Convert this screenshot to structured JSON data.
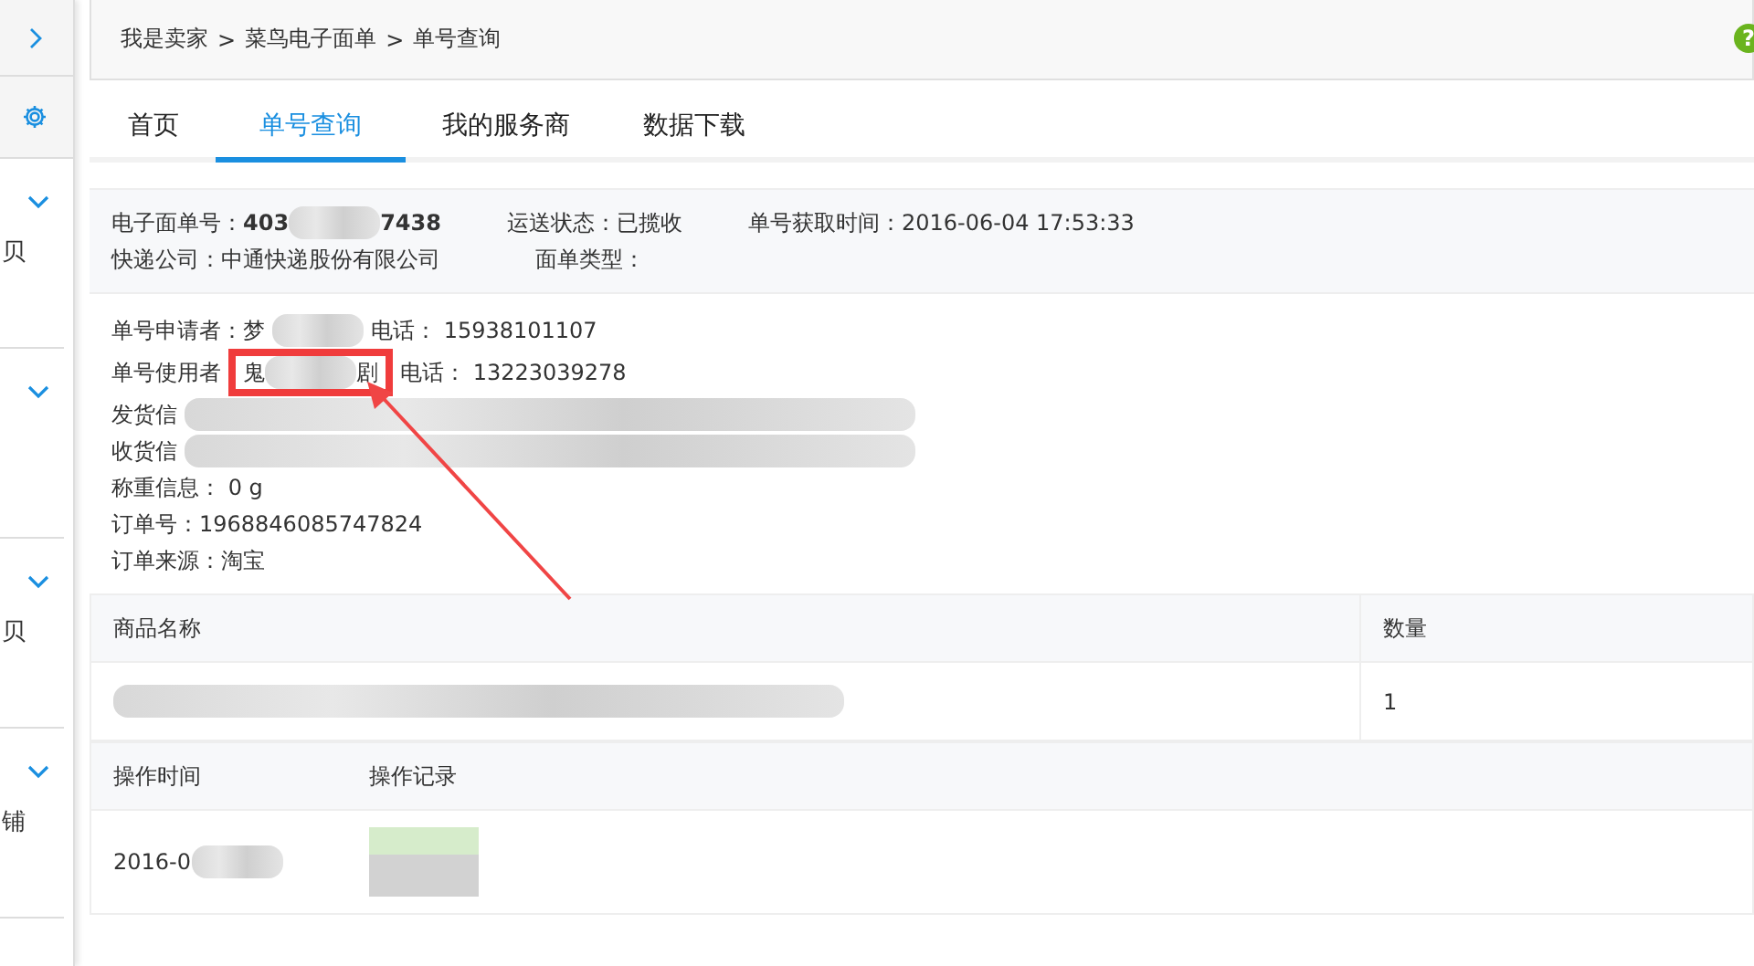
{
  "sidebar": {
    "items": [
      {
        "kind": "toggle"
      },
      {
        "kind": "settings"
      },
      {
        "kind": "group",
        "label": "贝"
      },
      {
        "kind": "group"
      },
      {
        "kind": "group",
        "label": "贝"
      },
      {
        "kind": "group",
        "label": "铺"
      }
    ]
  },
  "breadcrumb": {
    "items": [
      "我是卖家",
      "菜鸟电子面单",
      "单号查询"
    ],
    "separator": ">",
    "help_icon": "?"
  },
  "tabs": [
    {
      "label": "首页",
      "selected": false
    },
    {
      "label": "单号查询",
      "selected": true
    },
    {
      "label": "我的服务商",
      "selected": false
    },
    {
      "label": "数据下载",
      "selected": false
    }
  ],
  "summary": [
    [
      {
        "label": "电子面单号：",
        "segments": [
          {
            "kind": "text",
            "text": "403",
            "bold": true
          },
          {
            "kind": "blur_short"
          },
          {
            "kind": "text",
            "text": "7438",
            "bold": true
          }
        ]
      },
      {
        "label": "运送状态：",
        "segments": [
          {
            "kind": "text",
            "text": "已揽收"
          }
        ]
      },
      {
        "label": "单号获取时间：",
        "segments": [
          {
            "kind": "text",
            "text": "2016-06-04 17:53:33"
          }
        ]
      }
    ],
    [
      {
        "label": "快递公司：",
        "segments": [
          {
            "kind": "text",
            "text": "中通快递股份有限公司"
          }
        ]
      },
      {
        "label": "面单类型："
      }
    ]
  ],
  "details": [
    {
      "segments": [
        {
          "kind": "text",
          "text": "单号申请者：梦"
        },
        {
          "kind": "blur_short"
        },
        {
          "kind": "text",
          "text": "电话： 15938101107"
        }
      ]
    },
    {
      "segments": [
        {
          "kind": "text",
          "text": "单号使用者"
        },
        {
          "kind": "mark",
          "segments": [
            {
              "kind": "text",
              "text": "鬼"
            },
            {
              "kind": "blur_short"
            },
            {
              "kind": "text",
              "text": "剧"
            }
          ]
        },
        {
          "kind": "text",
          "text": "电话： 13223039278"
        }
      ]
    },
    {
      "segments": [
        {
          "kind": "text",
          "text": "发货信"
        },
        {
          "kind": "blur_long"
        }
      ]
    },
    {
      "segments": [
        {
          "kind": "text",
          "text": "收货信"
        },
        {
          "kind": "blur_long"
        }
      ]
    },
    {
      "segments": [
        {
          "kind": "text",
          "text": "称重信息： 0 g"
        }
      ]
    },
    {
      "segments": [
        {
          "kind": "text",
          "text": "订单号：1968846085747824"
        }
      ]
    },
    {
      "segments": [
        {
          "kind": "text",
          "text": "订单来源：淘宝"
        }
      ]
    }
  ],
  "annotation_arrow": true,
  "goods_table": {
    "columns": [
      "商品名称",
      "数量"
    ],
    "rows": [
      [
        [
          {
            "kind": "blur_long"
          }
        ],
        [
          {
            "kind": "text",
            "text": "1"
          }
        ]
      ]
    ]
  },
  "log_table": {
    "columns": [
      "操作时间",
      "操作记录"
    ],
    "rows": [
      [
        [
          {
            "kind": "text",
            "text": "2016-0"
          },
          {
            "kind": "blur_short"
          }
        ],
        [
          {
            "kind": "blur_green"
          }
        ]
      ]
    ]
  }
}
